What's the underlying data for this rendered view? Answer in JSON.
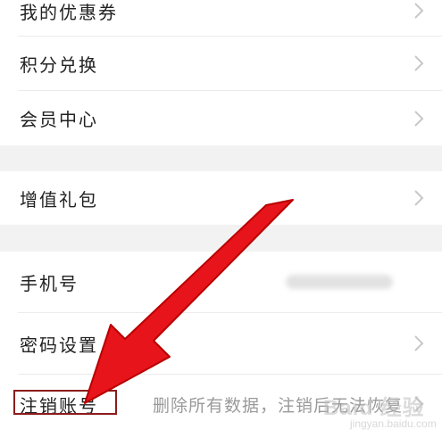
{
  "menu": {
    "group1": [
      {
        "label": "我的优惠券"
      },
      {
        "label": "积分兑换"
      },
      {
        "label": "会员中心"
      }
    ],
    "group2": [
      {
        "label": "增值礼包"
      }
    ],
    "group3": [
      {
        "label": "手机号",
        "value": ""
      },
      {
        "label": "密码设置"
      },
      {
        "label": "注销账号",
        "value": "删除所有数据，注销后无法恢复"
      }
    ]
  },
  "annotation": {
    "arrow_color": "#e8141b",
    "box_color": "#8c1c1c"
  },
  "watermark": {
    "text": "Baid 经验",
    "sub": "jingyan.baidu.com"
  },
  "icons": {
    "chevron": "chevron-right-icon"
  }
}
